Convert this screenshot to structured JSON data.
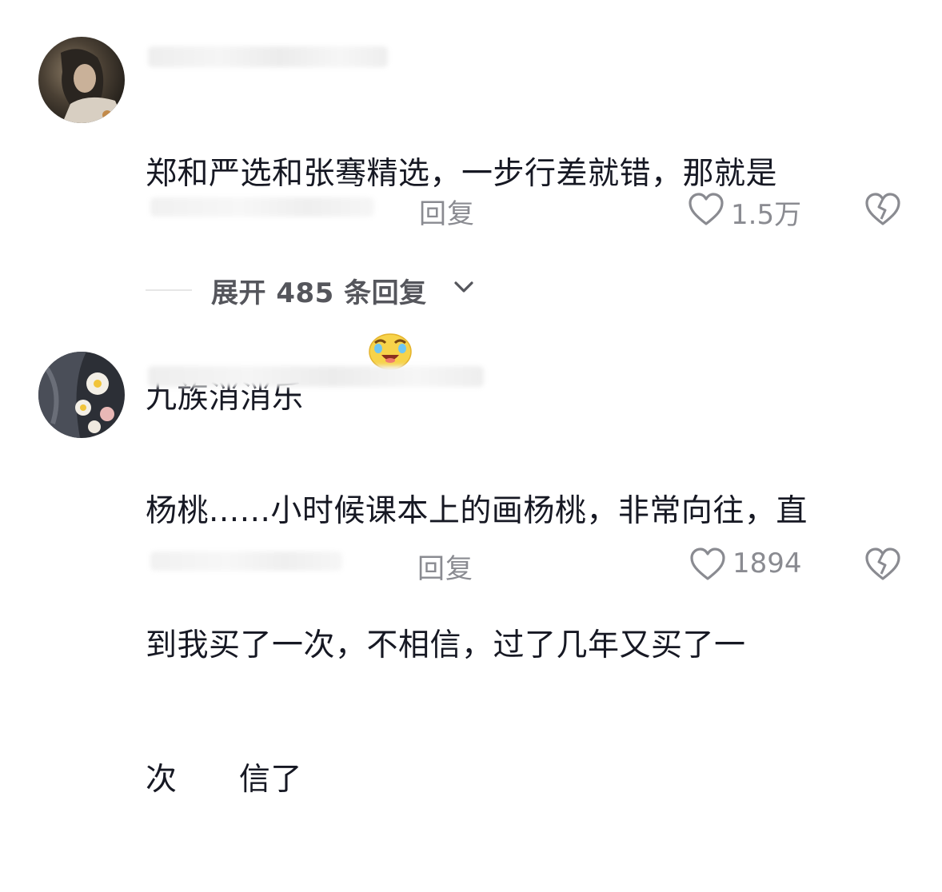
{
  "comments": [
    {
      "text_line1": "郑和严选和张骞精选，一步行差就错，那就是",
      "text_line2": "九族消消乐",
      "emoji": "crying-laughing-emoji",
      "reply_label": "回复",
      "like_count": "1.5万"
    },
    {
      "text_line1": "杨桃......小时候课本上的画杨桃，非常向往，直",
      "text_line2": "到我买了一次，不相信，过了几年又买了一",
      "text_line3": "次      信了",
      "reply_label": "回复",
      "like_count": "1894"
    }
  ],
  "expand": {
    "label": "展开 485 条回复"
  },
  "icons": {
    "like": "heart-outline-icon",
    "dislike": "broken-heart-icon",
    "expand": "chevron-down-icon"
  },
  "colors": {
    "text": "#161823",
    "secondary": "#8a8b91"
  }
}
